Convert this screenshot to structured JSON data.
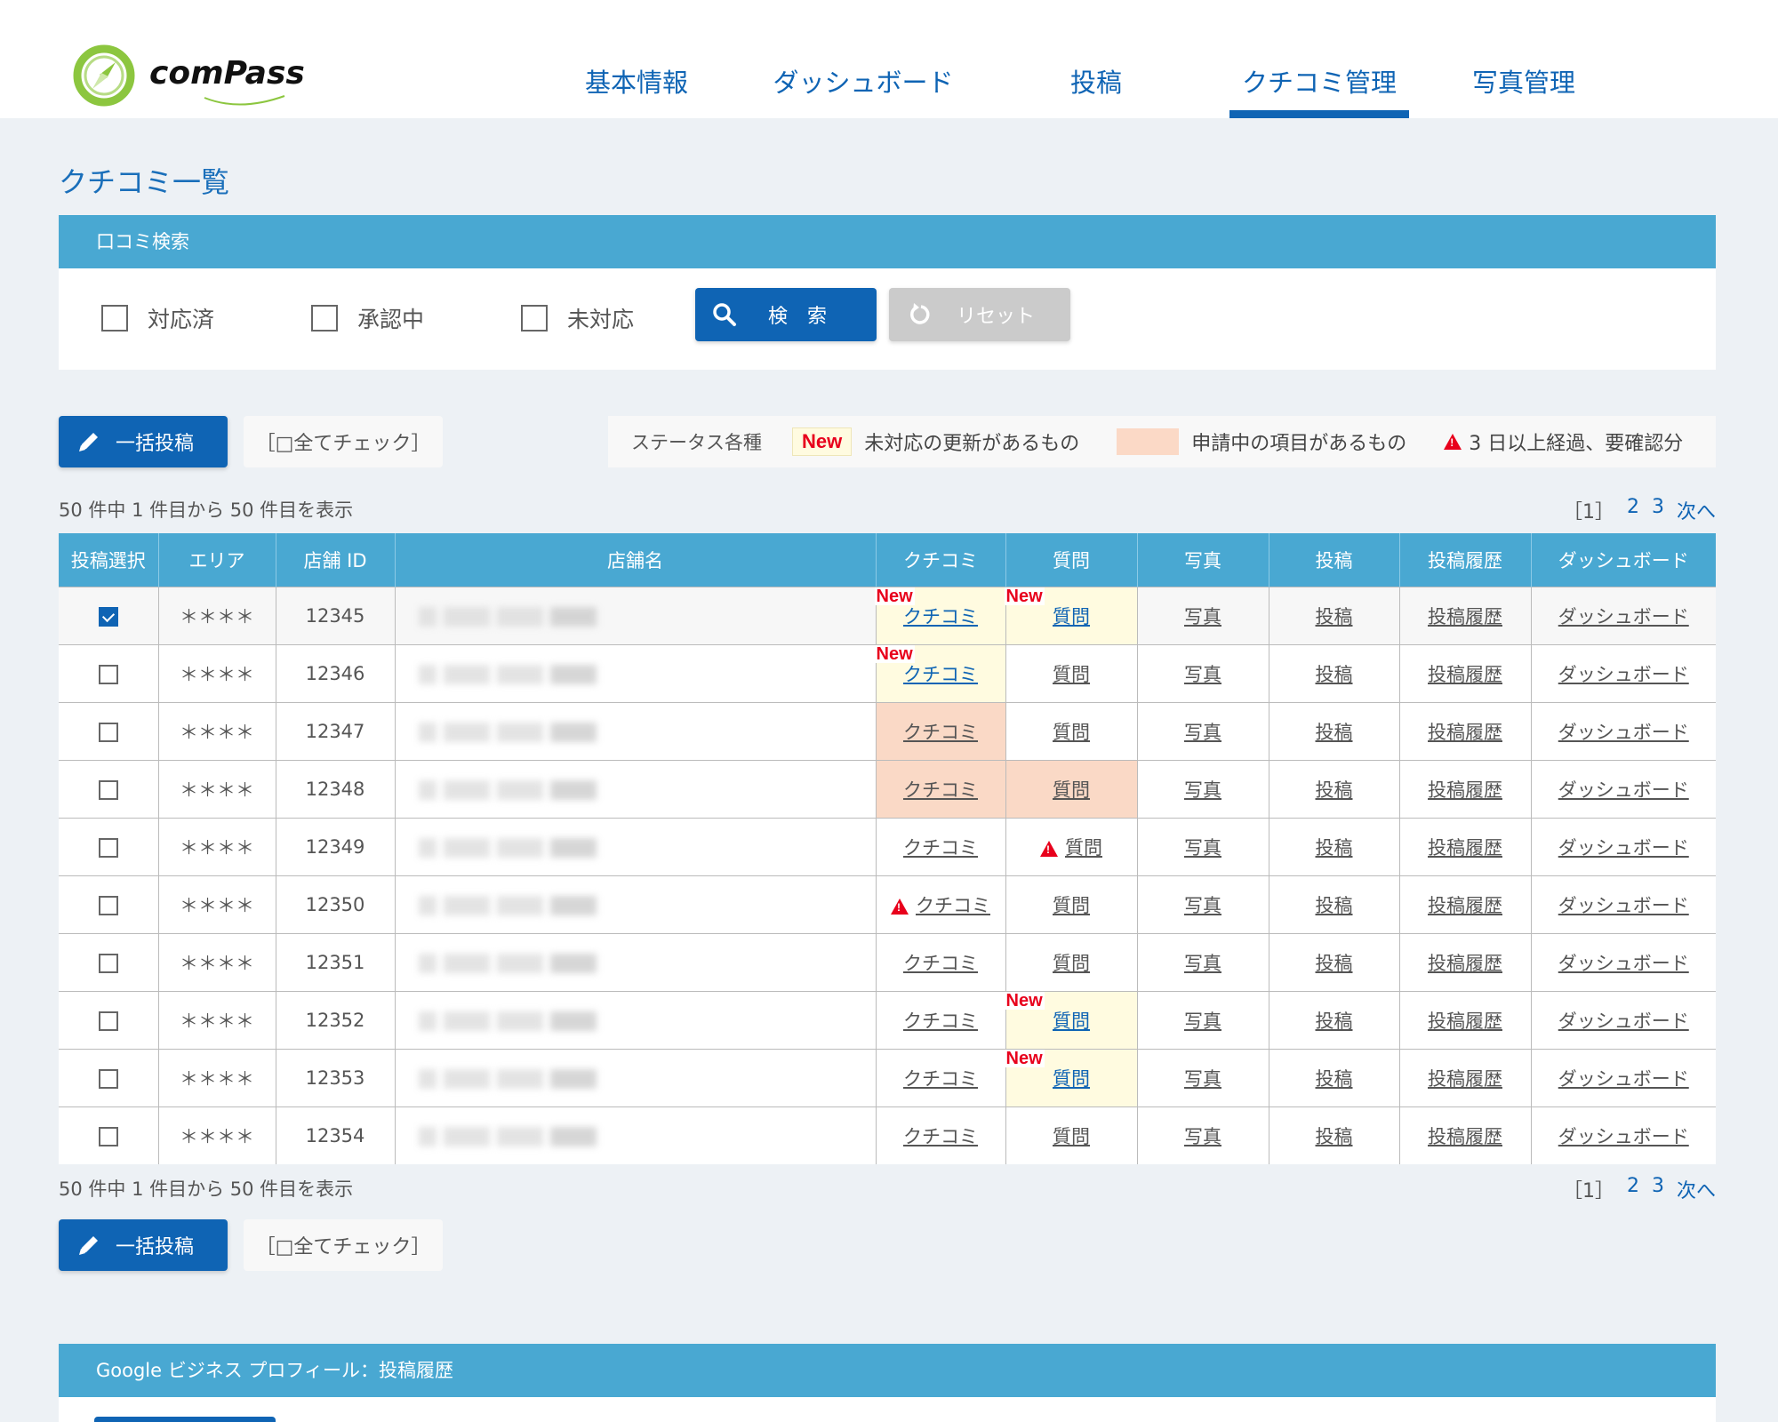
{
  "brand": {
    "logo_text": "comPass",
    "green": "#8cc63f"
  },
  "nav": {
    "items": [
      {
        "label": "基本情報"
      },
      {
        "label": "ダッシュボード"
      },
      {
        "label": "投稿"
      },
      {
        "label": "クチコミ管理",
        "active": true
      },
      {
        "label": "写真管理"
      }
    ]
  },
  "page_title": "クチコミ一覧",
  "search": {
    "heading": "口コミ検索",
    "filters": [
      {
        "label": "対応済",
        "checked": false
      },
      {
        "label": "承認中",
        "checked": false
      },
      {
        "label": "未対応",
        "checked": false
      }
    ],
    "search_label": "検　索",
    "reset_label": "リセット"
  },
  "actions": {
    "bulk_post_label": "一括投稿",
    "check_all_label": "［□全てチェック］"
  },
  "legend": {
    "title": "ステータス各種",
    "new_badge": "New",
    "new_desc": "未対応の更新があるもの",
    "pending_desc": "申請中の項目があるもの",
    "warn_desc": "3 日以上経過、要確認分"
  },
  "listing": {
    "count_text": "50 件中 1 件目から 50 件目を表示",
    "pager": {
      "current": "［1］",
      "pages": [
        "2",
        "3"
      ],
      "next": "次へ"
    }
  },
  "table": {
    "headers": [
      "投稿選択",
      "エリア",
      "店舗 ID",
      "店舗名",
      "クチコミ",
      "質問",
      "写真",
      "投稿",
      "投稿履歴",
      "ダッシュボード"
    ],
    "link_labels": {
      "review": "クチコミ",
      "question": "質問",
      "photo": "写真",
      "post": "投稿",
      "history": "投稿履歴",
      "dashboard": "ダッシュボード"
    },
    "rows": [
      {
        "checked": true,
        "area": "＊＊＊＊",
        "id": "12345",
        "name_redacted": true,
        "review": "new",
        "question": "new"
      },
      {
        "checked": false,
        "area": "＊＊＊＊",
        "id": "12346",
        "name_redacted": true,
        "review": "new",
        "question": ""
      },
      {
        "checked": false,
        "area": "＊＊＊＊",
        "id": "12347",
        "name_redacted": true,
        "review": "pending",
        "question": ""
      },
      {
        "checked": false,
        "area": "＊＊＊＊",
        "id": "12348",
        "name_redacted": true,
        "review": "pending",
        "question": "pending"
      },
      {
        "checked": false,
        "area": "＊＊＊＊",
        "id": "12349",
        "name_redacted": true,
        "review": "",
        "question": "warn"
      },
      {
        "checked": false,
        "area": "＊＊＊＊",
        "id": "12350",
        "name_redacted": true,
        "review": "warn",
        "question": ""
      },
      {
        "checked": false,
        "area": "＊＊＊＊",
        "id": "12351",
        "name_redacted": true,
        "review": "",
        "question": ""
      },
      {
        "checked": false,
        "area": "＊＊＊＊",
        "id": "12352",
        "name_redacted": true,
        "review": "",
        "question": "new"
      },
      {
        "checked": false,
        "area": "＊＊＊＊",
        "id": "12353",
        "name_redacted": true,
        "review": "",
        "question": "new"
      },
      {
        "checked": false,
        "area": "＊＊＊＊",
        "id": "12354",
        "name_redacted": true,
        "review": "",
        "question": ""
      }
    ]
  },
  "history_section": {
    "heading": "Google ビジネス プロフィール：投稿履歴"
  },
  "colors": {
    "primary": "#0f64b4",
    "panel_header": "#49a8d2",
    "new_bg": "#fffbe0",
    "pending_bg": "#fad9c6",
    "warn": "#e8001c"
  }
}
